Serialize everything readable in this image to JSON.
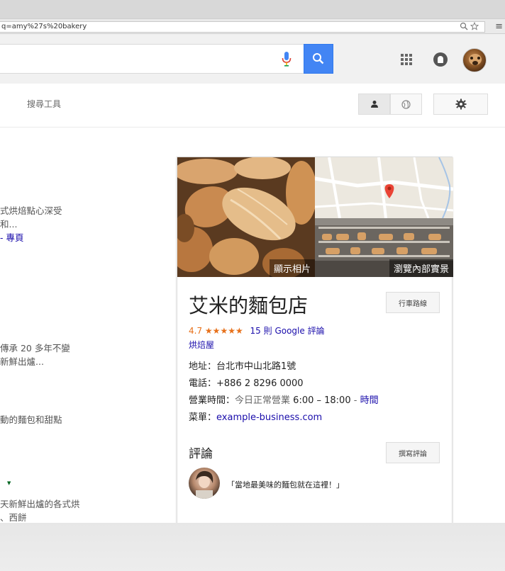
{
  "browser": {
    "url": "q=amy%27s%20bakery",
    "menu_glyph": "≡"
  },
  "search": {
    "query": ""
  },
  "toolbar": {
    "search_tools_label": "搜尋工具"
  },
  "results": [
    {
      "line1": "式烘焙點心深受",
      "line2": "和...",
      "link": "- 專頁"
    },
    {
      "line1": "傳承 20 多年不變",
      "line2": "新鮮出爐..."
    },
    {
      "line1": "動的麵包和甜點"
    },
    {
      "line1": "天新鮮出爐的各式烘",
      "line2": "、西餅"
    }
  ],
  "knowledge_panel": {
    "photos_label": "顯示相片",
    "interior_label": "瀏覽內部實景",
    "title": "艾米的麵包店",
    "directions_label": "行車路線",
    "rating": "4.7",
    "stars": "★★★★★",
    "reviews_link": "15 則 Google 評論",
    "category": "烘焙屋",
    "address_label": "地址：",
    "address": "台北市中山北路1號",
    "phone_label": "電話：",
    "phone": "+886 2 8296 0000",
    "hours_label": "營業時間：",
    "hours_status": "今日正常營業",
    "hours_range": "6:00 – 18:00",
    "hours_sep": " - ",
    "hours_link": "時間",
    "menu_label": "菜單：",
    "menu_link": "example-business.com",
    "reviews_heading": "評論",
    "write_review_label": "撰寫評論",
    "review_quote": "「當地最美味的麵包就在這裡！」"
  },
  "colors": {
    "link": "#1a0dab",
    "rating": "#e7711b",
    "search_button": "#4285f4",
    "map_pin": "#ea4335",
    "mic": "#4285f4"
  }
}
